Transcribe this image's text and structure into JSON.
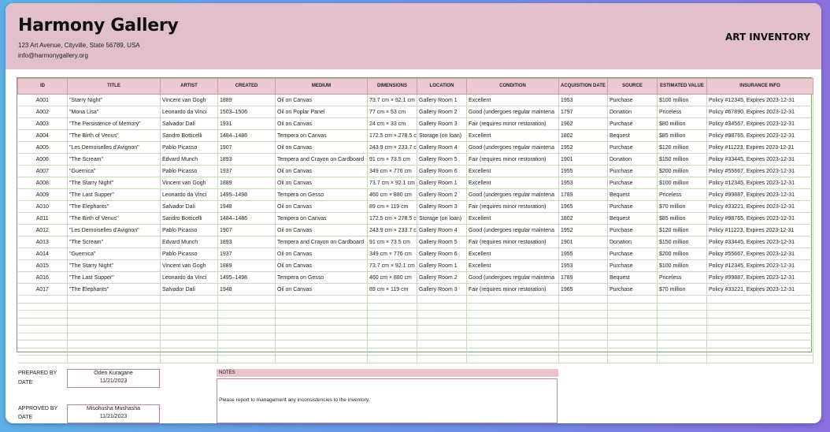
{
  "header": {
    "gallery_name": "Harmony Gallery",
    "address": "123 Art Avenue, Cityville, State 56789, USA",
    "email": "info@harmonygallery.org",
    "title": "ART INVENTORY"
  },
  "table": {
    "columns": [
      "ID",
      "TITLE",
      "ARTIST",
      "CREATED",
      "MEDIUM",
      "DIMENSIONS",
      "LOCATION",
      "CONDITION",
      "ACQUISITION DATE",
      "SOURCE",
      "ESTIMATED VALUE",
      "INSURANCE INFO"
    ],
    "rows": [
      [
        "A001",
        "\"Starry Night\"",
        "Vincent van Gogh",
        "1889",
        "Oil on Canvas",
        "73.7 cm × 92.1 cm",
        "Gallery Room 1",
        "Excellent",
        "1953",
        "Purchase",
        "$100 million",
        "Policy #12345, Expires 2023-12-31"
      ],
      [
        "A002",
        "\"Mona Lisa\"",
        "Leonardo da Vinci",
        "1503–1506",
        "Oil on Poplar Panel",
        "77 cm × 53 cm",
        "Gallery Room 2",
        "Good (undergoes regular maintena",
        "1797",
        "Donation",
        "Priceless",
        "Policy #67890, Expires 2023-12-31"
      ],
      [
        "A003",
        "\"The Persistence of Memory\"",
        "Salvador Dalí",
        "1931",
        "Oil on Canvas",
        "24 cm × 33 cm",
        "Gallery Room 3",
        "Fair (requires minor restoration)",
        "1962",
        "Purchase",
        "$80 million",
        "Policy #34567, Expires 2023-12-31"
      ],
      [
        "A004",
        "\"The Birth of Venus\"",
        "Sandro Botticelli",
        "1484–1486",
        "Tempera on Canvas",
        "172.5 cm × 278.5 c",
        "Storage (on loan)",
        "Excellent",
        "1802",
        "Bequest",
        "$85 million",
        "Policy #98765, Expires 2023-12-31"
      ],
      [
        "A005",
        "\"Les Demoiselles d'Avignon\"",
        "Pablo Picasso",
        "1907",
        "Oil on Canvas",
        "243.9 cm × 233.7 c",
        "Gallery Room 4",
        "Good (undergoes regular maintena",
        "1952",
        "Purchase",
        "$120 million",
        "Policy #11223, Expires 2023-12-31"
      ],
      [
        "A006",
        "\"The Scream\"",
        "Edvard Munch",
        "1893",
        "Tempera and Crayon on Cardboard",
        "91 cm × 73.5 cm",
        "Gallery Room 5",
        "Fair (requires minor restoration)",
        "1901",
        "Donation",
        "$150 million",
        "Policy #33445, Expires 2023-12-31"
      ],
      [
        "A007",
        "\"Guernica\"",
        "Pablo Picasso",
        "1937",
        "Oil on Canvas",
        "349 cm × 776 cm",
        "Gallery Room 6",
        "Excellent",
        "1955",
        "Purchase",
        "$200 million",
        "Policy #55667, Expires 2023-12-31"
      ],
      [
        "A008",
        "\"The Starry Night\"",
        "Vincent van Gogh",
        "1889",
        "Oil on Canvas",
        "73.7 cm × 92.1 cm",
        "Gallery Room 1",
        "Excellent",
        "1953",
        "Purchase",
        "$100 million",
        "Policy #12345, Expires 2023-12-31"
      ],
      [
        "A009",
        "\"The Last Supper\"",
        "Leonardo da Vinci",
        "1495–1498",
        "Tempera on Gesso",
        "460 cm × 880 cm",
        "Gallery Room 2",
        "Good (undergoes regular maintena",
        "1789",
        "Bequest",
        "Priceless",
        "Policy #99887, Expires 2023-12-31"
      ],
      [
        "A010",
        "\"The Elephants\"",
        "Salvador Dalí",
        "1948",
        "Oil on Canvas",
        "89 cm × 119 cm",
        "Gallery Room 3",
        "Fair (requires minor restoration)",
        "1965",
        "Purchase",
        "$70 million",
        "Policy #33221, Expires 2023-12-31"
      ],
      [
        "A011",
        "\"The Birth of Venus\"",
        "Sandro Botticelli",
        "1484–1486",
        "Tempera on Canvas",
        "172.5 cm × 278.5 c",
        "Storage (on loan)",
        "Excellent",
        "1802",
        "Bequest",
        "$85 million",
        "Policy #98765, Expires 2023-12-31"
      ],
      [
        "A012",
        "\"Les Demoiselles d'Avignon\"",
        "Pablo Picasso",
        "1907",
        "Oil on Canvas",
        "243.9 cm × 233.7 c",
        "Gallery Room 4",
        "Good (undergoes regular maintena",
        "1952",
        "Purchase",
        "$120 million",
        "Policy #11223, Expires 2023-12-31"
      ],
      [
        "A013",
        "\"The Scream\"",
        "Edvard Munch",
        "1893",
        "Tempera and Crayon on Cardboard",
        "91 cm × 73.5 cm",
        "Gallery Room 5",
        "Fair (requires minor restoration)",
        "1901",
        "Donation",
        "$150 million",
        "Policy #33445, Expires 2023-12-31"
      ],
      [
        "A014",
        "\"Guernica\"",
        "Pablo Picasso",
        "1937",
        "Oil on Canvas",
        "349 cm × 776 cm",
        "Gallery Room 6",
        "Excellent",
        "1955",
        "Purchase",
        "$200 million",
        "Policy #55667, Expires 2023-12-31"
      ],
      [
        "A015",
        "\"The Starry Night\"",
        "Vincent van Gogh",
        "1889",
        "Oil on Canvas",
        "73.7 cm × 92.1 cm",
        "Gallery Room 1",
        "Excellent",
        "1953",
        "Purchase",
        "$100 million",
        "Policy #12345, Expires 2023-12-31"
      ],
      [
        "A016",
        "\"The Last Supper\"",
        "Leonardo da Vinci",
        "1495–1498",
        "Tempera on Gesso",
        "460 cm × 880 cm",
        "Gallery Room 2",
        "Good (undergoes regular maintena",
        "1789",
        "Bequest",
        "Priceless",
        "Policy #99887, Expires 2023-12-31"
      ],
      [
        "A017",
        "\"The Elephants\"",
        "Salvador Dalí",
        "1948",
        "Oil on Canvas",
        "89 cm × 119 cm",
        "Gallery Room 3",
        "Fair (requires minor restoration)",
        "1965",
        "Purchase",
        "$70 million",
        "Policy #33221, Expires 2023-12-31"
      ]
    ]
  },
  "footer": {
    "prepared_by_label": "PREPARED BY",
    "date_label": "DATE",
    "prepared_by": "Oden Kuragane",
    "prepared_date": "11/21/2023",
    "approved_by_label": "APPROVED BY",
    "approved_by": "Misohusha Mushasha",
    "approved_date": "11/21/2023",
    "notes_label": "NOTES",
    "notes_text": "Please report to management any inconsistencies to the inventory."
  }
}
